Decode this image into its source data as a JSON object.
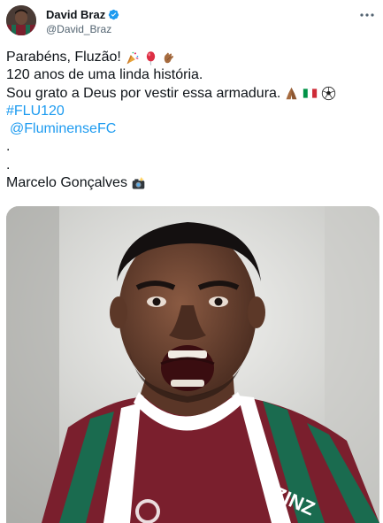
{
  "author": {
    "name": "David Braz",
    "handle": "@David_Braz",
    "verified": true,
    "avatar_icon": "avatar-photo-icon"
  },
  "menu_icon": "more-options-icon",
  "text": {
    "line1": "Parabéns, Fluzão!",
    "line1_emojis": [
      "party-popper-icon",
      "red-balloon-icon",
      "clapping-hands-icon"
    ],
    "line2": "120 anos de uma linda história.",
    "line3": "Sou grato a Deus por vestir essa armadura.",
    "line3_emojis": [
      "praying-hands-icon",
      "italy-flag-icon",
      "soccer-ball-icon"
    ],
    "hashtag": "#FLU120",
    "mention": "@FluminenseFC",
    "dot1": ".",
    "dot2": ".",
    "credit": "Marcelo Gonçalves",
    "credit_emoji": "camera-flash-icon"
  },
  "media": {
    "type": "photo",
    "description_icon": "player-celebration-photo",
    "jersey_text": "ZINZ"
  },
  "colors": {
    "link": "#1d9bf0",
    "secondary_text": "#536471",
    "primary_text": "#0f1419",
    "verified_badge": "#1d9bf0",
    "jersey_maroon": "#7a1f2d",
    "jersey_green": "#1a6b4f"
  }
}
